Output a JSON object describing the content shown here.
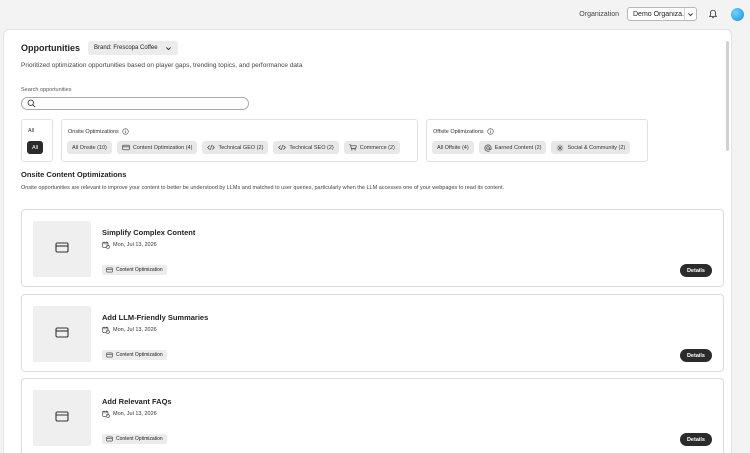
{
  "topbar": {
    "org_label": "Organization",
    "org_value": "Demo Organiza...",
    "icons": [
      "chevron-down-icon",
      "bell-icon",
      "avatar"
    ]
  },
  "header": {
    "title": "Opportunities",
    "brand_picker": "Brand: Frescopa Coffee",
    "subtitle": "Prioritized optimization opportunities based on player gaps, trending topics, and performance data"
  },
  "search": {
    "label": "Search opportunities",
    "value": "",
    "placeholder": ""
  },
  "filters": {
    "all": {
      "label": "All",
      "chip": "All"
    },
    "onsite": {
      "label": "Onsite Optimizations",
      "chips": [
        "All Onsite (10)",
        "Content Optimization (4)",
        "Technical GEO (2)",
        "Technical SEO (2)",
        "Commerce (2)"
      ]
    },
    "offsite": {
      "label": "Offsite Optimizations",
      "chips": [
        "All Offsite (4)",
        "Earned Content (2)",
        "Social & Community (2)"
      ]
    }
  },
  "section": {
    "title": "Onsite Content Optimizations",
    "description": "Onsite opportunities are relevant to improve your content to better be understood by LLMs and matched to user queries, particularly when the LLM accesses one of your webpages to read its content."
  },
  "cards": [
    {
      "title": "Simplify Complex Content",
      "date": "Mon, Jul 13, 2026",
      "tag": "Content Optimization",
      "button": "Details"
    },
    {
      "title": "Add LLM-Friendly Summaries",
      "date": "Mon, Jul 13, 2026",
      "tag": "Content Optimization",
      "button": "Details"
    },
    {
      "title": "Add Relevant FAQs",
      "date": "Mon, Jul 13, 2026",
      "tag": "Content Optimization",
      "button": "Details"
    }
  ],
  "colors": {
    "dark_button": "#2b2b2b",
    "chip_bg": "#e8e8e8",
    "page_bg": "#f3f3f3",
    "avatar": "#1a8fd6"
  }
}
